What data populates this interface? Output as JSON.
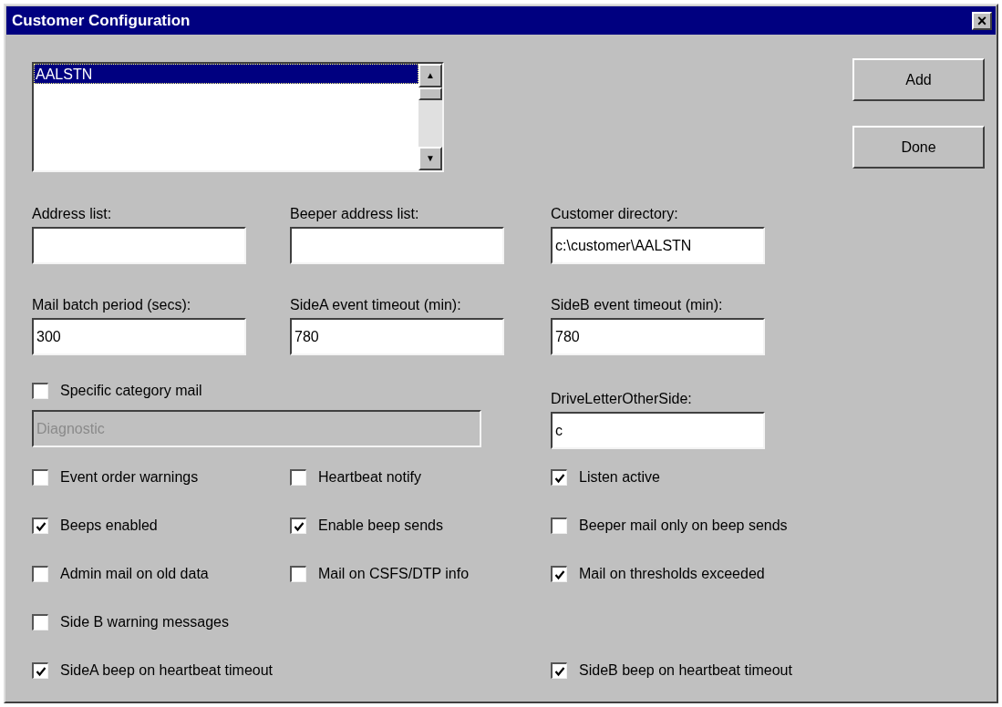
{
  "window": {
    "title": "Customer Configuration",
    "close": "×"
  },
  "customers": {
    "items": [
      {
        "label": "AALSTN",
        "selected": true
      }
    ],
    "scroll_up": "▲",
    "scroll_down": "▼"
  },
  "buttons": [
    "Add",
    "Done"
  ],
  "fields": [
    {
      "label": "Address list:"
    },
    {
      "label": "Beeper address list:"
    },
    {
      "label": "Customer directory:",
      "value": "c:\\customer\\AALSTN"
    },
    {
      "label": "Mail batch period (secs):",
      "value": "300"
    },
    {
      "label": "SideA event timeout (min):",
      "value": "780"
    },
    {
      "label": "SideB event timeout (min):",
      "value": "780"
    }
  ],
  "category_mail": {
    "label": "Specific category mail",
    "checked": false,
    "value": "Diagnostic",
    "disabled": true
  },
  "drive_letter": {
    "label": "DriveLetterOtherSide:",
    "value": "c"
  },
  "checkbox_rows": [
    [
      {
        "label": "Event order warnings",
        "checked": false
      },
      {
        "label": "Heartbeat notify",
        "checked": false
      },
      {
        "label": "Listen active",
        "checked": true
      }
    ],
    [
      {
        "label": "Beeps enabled",
        "checked": true
      },
      {
        "label": "Enable beep sends",
        "checked": true
      },
      {
        "label": "Beeper mail only on beep sends",
        "checked": false
      }
    ],
    [
      {
        "label": "Admin mail on old data",
        "checked": false
      },
      {
        "label": "Mail on CSFS/DTP info",
        "checked": false
      },
      {
        "label": "Mail on thresholds exceeded",
        "checked": true
      }
    ],
    [
      {
        "label": "Side B warning messages",
        "checked": false
      },
      null,
      null
    ],
    [
      {
        "label": "SideA beep on heartbeat timeout",
        "checked": true
      },
      null,
      {
        "label": "SideB beep on heartbeat timeout",
        "checked": true
      }
    ]
  ]
}
